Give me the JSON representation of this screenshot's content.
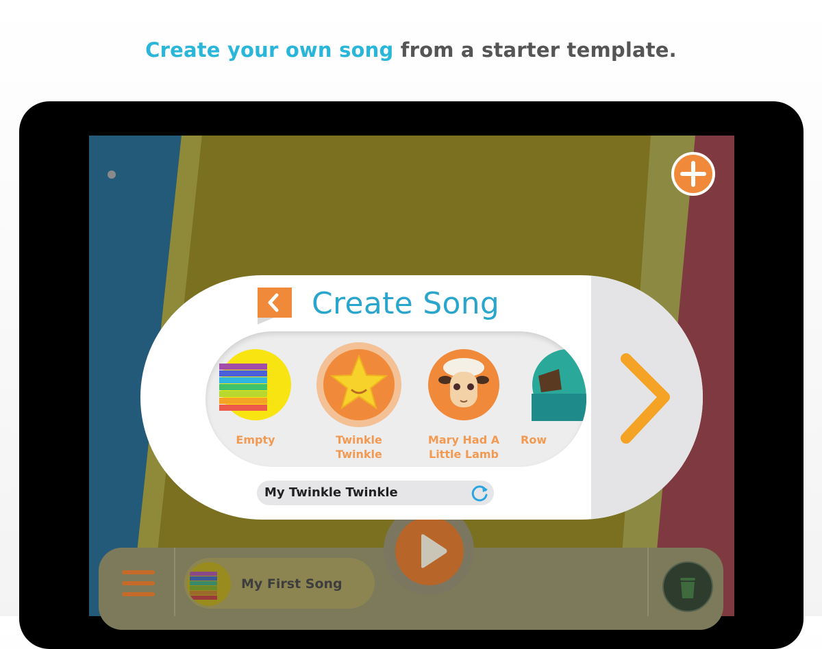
{
  "headline": {
    "highlight": "Create your own song",
    "rest": " from a starter template."
  },
  "dialog": {
    "title": "Create Song",
    "templates": [
      {
        "label_line1": "Empty",
        "label_line2": "",
        "icon": "rainbow-xylophone-icon"
      },
      {
        "label_line1": "Twinkle",
        "label_line2": "Twinkle",
        "icon": "star-icon"
      },
      {
        "label_line1": "Mary Had A",
        "label_line2": "Little Lamb",
        "icon": "lamb-icon"
      },
      {
        "label_line1": "Row",
        "label_line2": "",
        "icon": "boat-icon"
      }
    ],
    "song_name": "My Twinkle Twinkle",
    "back_icon": "chevron-left-icon",
    "next_icon": "chevron-right-icon",
    "refresh_icon": "refresh-icon"
  },
  "toolbar": {
    "current_song": "My First Song",
    "menu_icon": "hamburger-icon",
    "trash_icon": "trash-icon",
    "play_icon": "play-icon",
    "add_icon": "plus-icon"
  },
  "colors": {
    "accent_blue": "#29b6d8",
    "accent_orange": "#f08a3a",
    "label_orange": "#f29a52"
  }
}
